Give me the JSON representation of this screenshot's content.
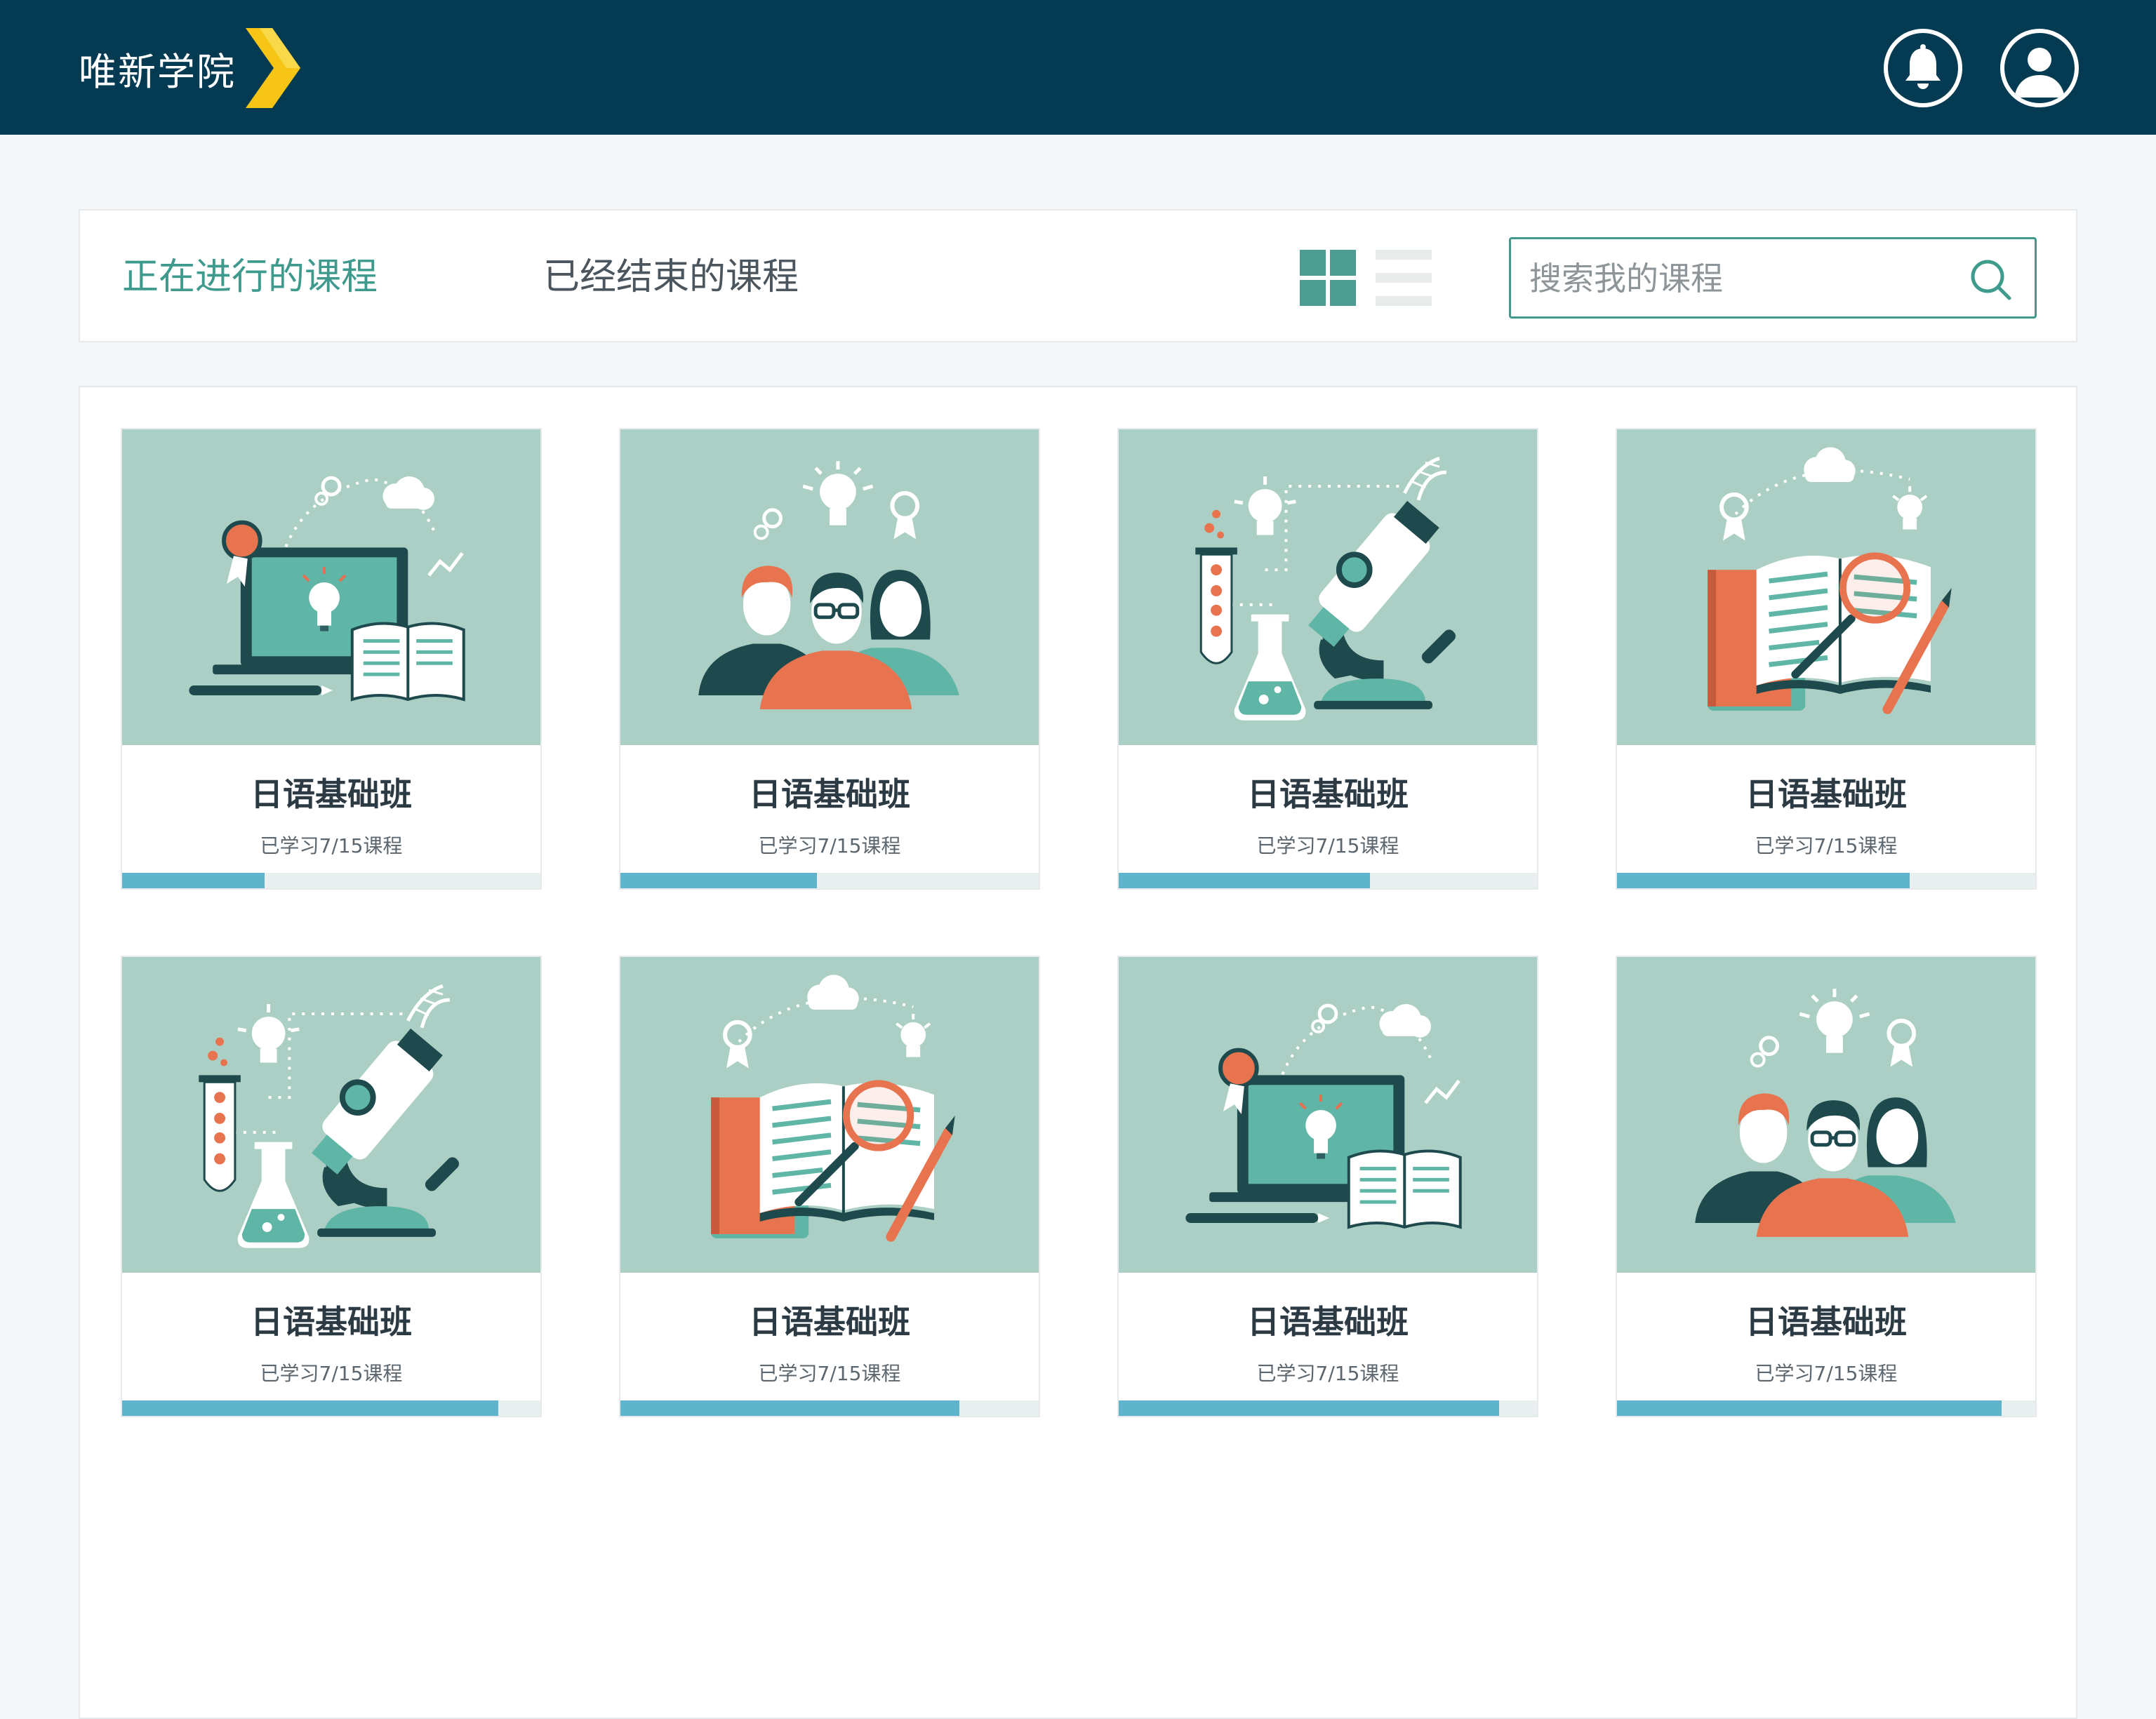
{
  "header": {
    "brand": "唯新学院",
    "accent_color": "#043b52",
    "brand_chevron_color": "#f6c515",
    "notification_icon": "bell-icon",
    "profile_icon": "user-avatar-icon"
  },
  "toolbar": {
    "tabs": [
      {
        "label": "正在进行的课程",
        "active": true
      },
      {
        "label": "已经结束的课程",
        "active": false
      }
    ],
    "view_modes": [
      "grid-view-icon",
      "list-view-icon"
    ],
    "active_view": "grid",
    "search": {
      "placeholder": "搜索我的课程",
      "value": "",
      "icon": "search-icon"
    }
  },
  "courses": [
    {
      "title": "日语基础班",
      "progress_text": "已学习7/15课程",
      "progress": 0.34,
      "illustration": "laptop-book"
    },
    {
      "title": "日语基础班",
      "progress_text": "已学习7/15课程",
      "progress": 0.47,
      "illustration": "people"
    },
    {
      "title": "日语基础班",
      "progress_text": "已学习7/15课程",
      "progress": 0.6,
      "illustration": "microscope"
    },
    {
      "title": "日语基础班",
      "progress_text": "已学习7/15课程",
      "progress": 0.7,
      "illustration": "book-magnifier"
    },
    {
      "title": "日语基础班",
      "progress_text": "已学习7/15课程",
      "progress": 0.9,
      "illustration": "microscope"
    },
    {
      "title": "日语基础班",
      "progress_text": "已学习7/15课程",
      "progress": 0.81,
      "illustration": "book-magnifier"
    },
    {
      "title": "日语基础班",
      "progress_text": "已学习7/15课程",
      "progress": 0.91,
      "illustration": "laptop-book"
    },
    {
      "title": "日语基础班",
      "progress_text": "已学习7/15课程",
      "progress": 0.92,
      "illustration": "people"
    }
  ],
  "colors": {
    "thumbnail_bg": "#abcfc4",
    "progress_fill": "#5eb5cb",
    "progress_track": "#e9eeee",
    "active_tab": "#3d9a8c"
  }
}
